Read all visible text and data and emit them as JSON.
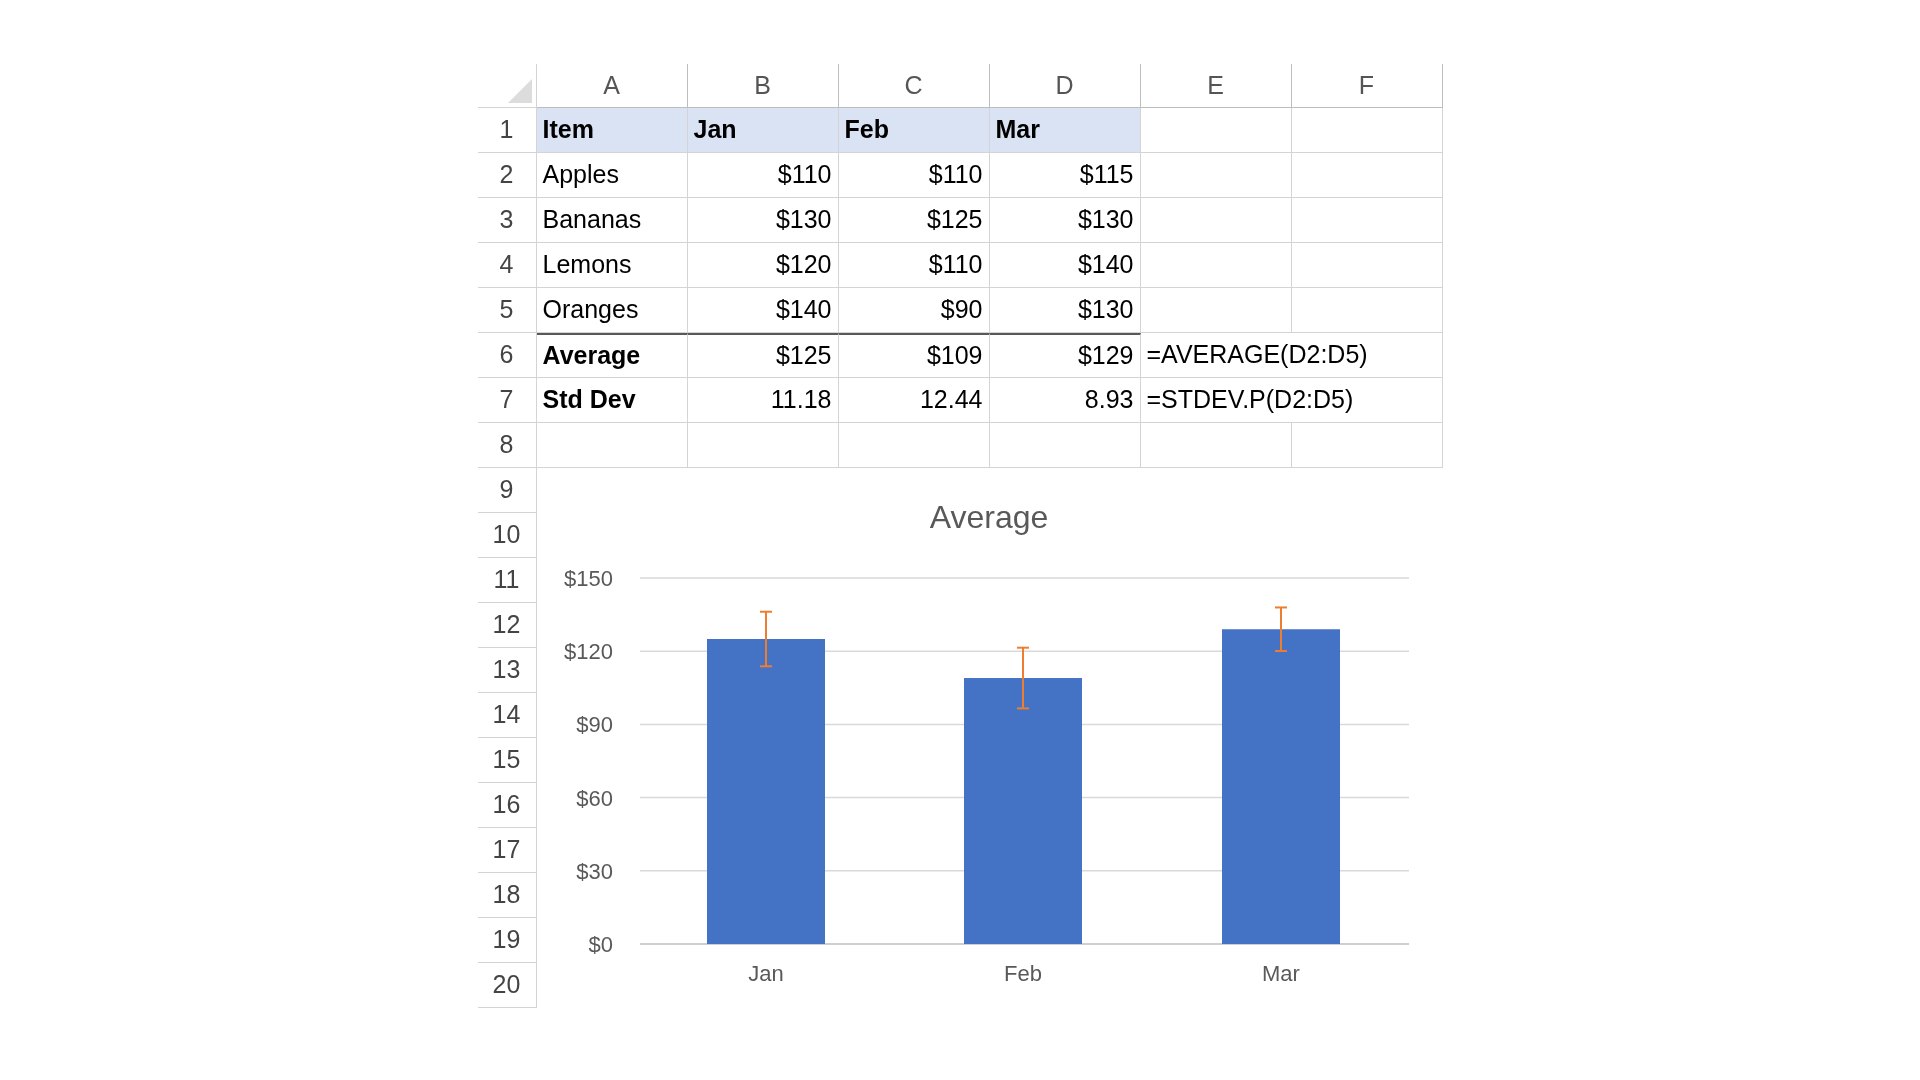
{
  "columns": [
    "A",
    "B",
    "C",
    "D",
    "E",
    "F"
  ],
  "rows": [
    {
      "number": "1",
      "kind": "header",
      "cells": [
        "Item",
        "Jan",
        "Feb",
        "Mar"
      ]
    },
    {
      "number": "2",
      "kind": "data",
      "cells": [
        "Apples",
        "$110",
        "$110",
        "$115"
      ]
    },
    {
      "number": "3",
      "kind": "data",
      "cells": [
        "Bananas",
        "$130",
        "$125",
        "$130"
      ]
    },
    {
      "number": "4",
      "kind": "data",
      "cells": [
        "Lemons",
        "$120",
        "$110",
        "$140"
      ]
    },
    {
      "number": "5",
      "kind": "data",
      "cells": [
        "Oranges",
        "$140",
        "$90",
        "$130"
      ]
    },
    {
      "number": "6",
      "kind": "summary",
      "cells": [
        "Average",
        "$125",
        "$109",
        "$129"
      ],
      "note": "=AVERAGE(D2:D5)"
    },
    {
      "number": "7",
      "kind": "summary",
      "cells": [
        "Std Dev",
        "11.18",
        "12.44",
        "8.93"
      ],
      "note": "=STDEV.P(D2:D5)"
    },
    {
      "number": "8",
      "kind": "empty",
      "cells": []
    }
  ],
  "chart_row_numbers": [
    "9",
    "10",
    "11",
    "12",
    "13",
    "14",
    "15",
    "16",
    "17",
    "18",
    "19",
    "20"
  ],
  "chart": {
    "chart_data": {
      "type": "bar",
      "title": "Average",
      "categories": [
        "Jan",
        "Feb",
        "Mar"
      ],
      "series": [
        {
          "color": "#4472c4",
          "values": [
            125,
            109,
            129
          ],
          "errors": [
            11.18,
            12.44,
            8.93
          ]
        }
      ],
      "grid": true,
      "ylim": [
        0,
        150
      ],
      "yticks": [
        {
          "value": 0,
          "label": "$0"
        },
        {
          "value": 30,
          "label": "$30"
        },
        {
          "value": 60,
          "label": "$60"
        },
        {
          "value": 90,
          "label": "$90"
        },
        {
          "value": 120,
          "label": "$120"
        },
        {
          "value": 150,
          "label": "$150"
        }
      ]
    }
  }
}
